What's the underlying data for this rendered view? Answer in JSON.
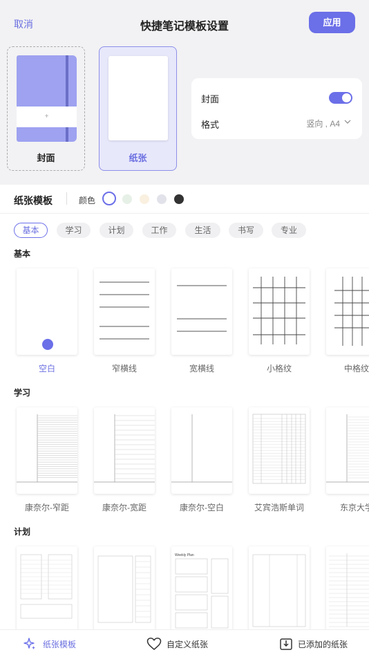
{
  "header": {
    "cancel_label": "取消",
    "title": "快捷笔记模板设置",
    "apply_label": "应用"
  },
  "preview": {
    "cover_label": "封面",
    "cover_plus": "+",
    "paper_label": "纸张"
  },
  "settings": {
    "cover_label": "封面",
    "cover_enabled": true,
    "format_label": "格式",
    "format_value": "竖向 , A4"
  },
  "template_bar": {
    "title": "纸张模板",
    "color_label": "颜色",
    "colors": [
      "#ffffff",
      "#e6f0e6",
      "#faf0e0",
      "#e2e2ea",
      "#333333"
    ],
    "selected_color": 0
  },
  "categories": [
    "基本",
    "学习",
    "计划",
    "工作",
    "生活",
    "书写",
    "专业"
  ],
  "sections": [
    {
      "title": "基本",
      "items": [
        "空白",
        "窄横线",
        "宽横线",
        "小格纹",
        "中格纹"
      ]
    },
    {
      "title": "学习",
      "items": [
        "康奈尔-窄距",
        "康奈尔-宽距",
        "康奈尔-空白",
        "艾宾浩斯单词",
        "东京大学"
      ]
    },
    {
      "title": "计划",
      "items": []
    }
  ],
  "bottom_tabs": [
    {
      "label": "纸张模板",
      "icon": "sparkle-icon"
    },
    {
      "label": "自定义纸张",
      "icon": "heart-icon"
    },
    {
      "label": "已添加的纸张",
      "icon": "import-icon"
    }
  ],
  "accent_color": "#6b6fe8"
}
